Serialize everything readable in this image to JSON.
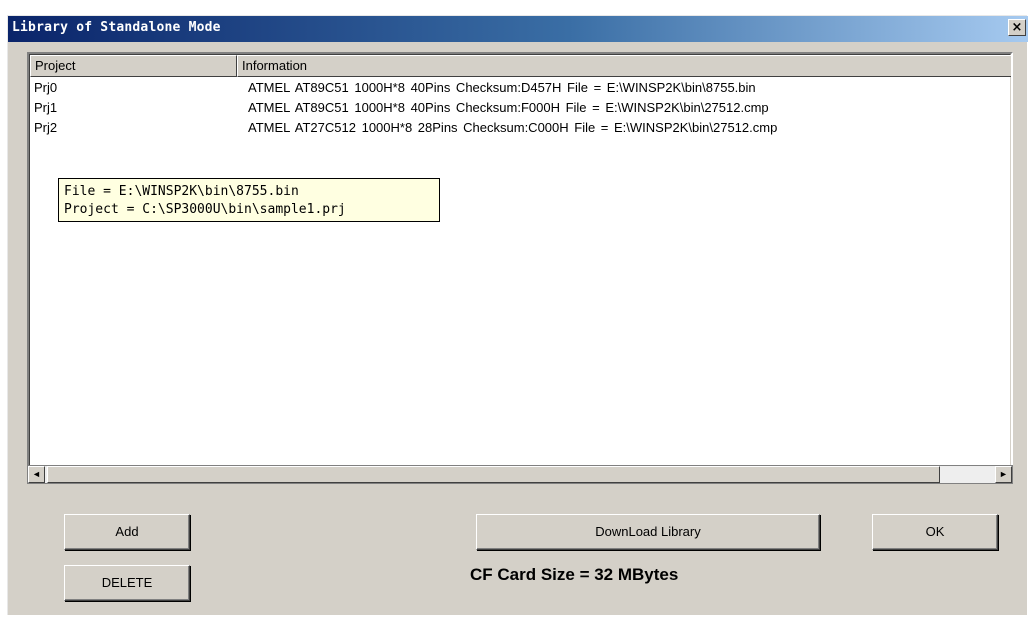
{
  "window": {
    "title": "Library of Standalone Mode",
    "close_label": "×"
  },
  "list": {
    "columns": [
      "Project",
      "Information"
    ],
    "rows": [
      {
        "project": "Prj0",
        "info": "ATMEL AT89C51 1000H*8 40Pins Checksum:D457H File = E:\\WINSP2K\\bin\\8755.bin"
      },
      {
        "project": "Prj1",
        "info": "ATMEL AT89C51 1000H*8 40Pins Checksum:F000H File = E:\\WINSP2K\\bin\\27512.cmp"
      },
      {
        "project": "Prj2",
        "info": "ATMEL AT27C512 1000H*8 28Pins Checksum:C000H File = E:\\WINSP2K\\bin\\27512.cmp"
      }
    ]
  },
  "tooltip": {
    "line1": "File = E:\\WINSP2K\\bin\\8755.bin",
    "line2": "Project = C:\\SP3000U\\bin\\sample1.prj"
  },
  "scrollbar": {
    "left_arrow": "◄",
    "right_arrow": "►"
  },
  "buttons": {
    "add": "Add",
    "delete": "DELETE",
    "download": "DownLoad Library",
    "ok": "OK"
  },
  "status": {
    "cf_card_size": "CF Card Size = 32 MBytes"
  }
}
